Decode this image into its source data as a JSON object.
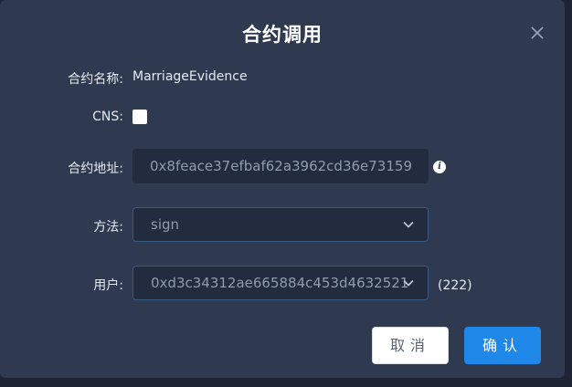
{
  "dialog": {
    "title": "合约调用",
    "close_icon": "close-icon"
  },
  "form": {
    "contract_name": {
      "label": "合约名称:",
      "value": "MarriageEvidence"
    },
    "cns": {
      "label": "CNS:",
      "checked": false
    },
    "contract_address": {
      "label": "合约地址:",
      "value": "0x8feace37efbaf62a3962cd36e73159",
      "info_icon": "info-icon"
    },
    "method": {
      "label": "方法:",
      "value": "sign",
      "icon": "chevron-down-icon"
    },
    "user": {
      "label": "用户:",
      "value": "0xd3c34312ae665884c453d4632521",
      "suffix": "(222)",
      "icon": "chevron-down-icon"
    }
  },
  "actions": {
    "cancel_label": "取消",
    "confirm_label": "确认"
  },
  "colors": {
    "dialog_bg": "#2f3a50",
    "input_bg": "#232c3e",
    "select_border": "#3a5a86",
    "primary": "#1f87e8"
  }
}
